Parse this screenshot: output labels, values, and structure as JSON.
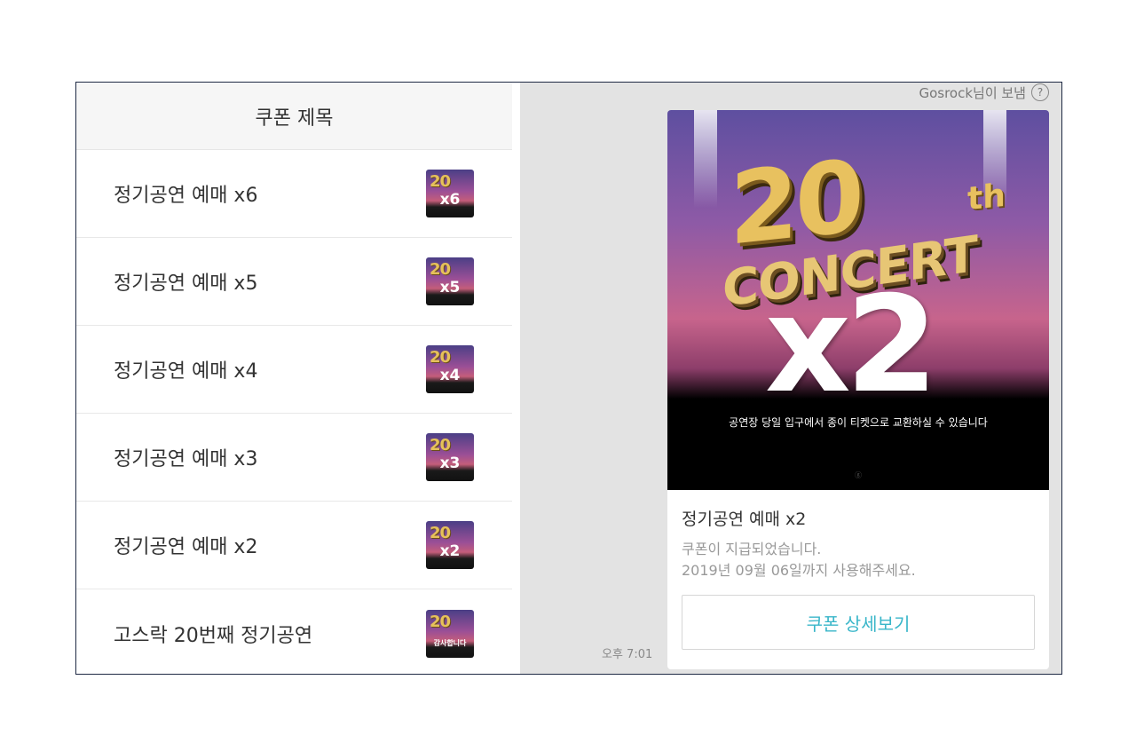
{
  "list": {
    "header": "쿠폰 제목",
    "items": [
      {
        "label": "정기공연 예매 x6",
        "thumb_top": "20",
        "thumb_text": "x6"
      },
      {
        "label": "정기공연 예매 x5",
        "thumb_top": "20",
        "thumb_text": "x5"
      },
      {
        "label": "정기공연 예매 x4",
        "thumb_top": "20",
        "thumb_text": "x4"
      },
      {
        "label": "정기공연 예매 x3",
        "thumb_top": "20",
        "thumb_text": "x3"
      },
      {
        "label": "정기공연 예매 x2",
        "thumb_top": "20",
        "thumb_text": "x2"
      },
      {
        "label": "고스락 20번째 정기공연",
        "thumb_top": "20",
        "thumb_text": "감사합니다"
      }
    ]
  },
  "chat": {
    "sender": "Gosrock님이 보냄",
    "help_icon": "?",
    "timestamp": "오후 7:01",
    "card": {
      "poster": {
        "number": "20",
        "suffix": "th",
        "word": "CONCERT",
        "multiplier": "x2",
        "note": "공연장 당일 입구에서 종이 티켓으로 교환하실 수 있습니다",
        "mark": "ⓖ"
      },
      "title": "정기공연 예매 x2",
      "desc_line1": "쿠폰이 지급되었습니다.",
      "desc_line2": "2019년 09월 06일까지 사용해주세요.",
      "button": "쿠폰 상세보기"
    }
  },
  "colors": {
    "accent": "#39b6c9",
    "chat_bg": "#e3e3e3",
    "border": "#1f2a44"
  }
}
